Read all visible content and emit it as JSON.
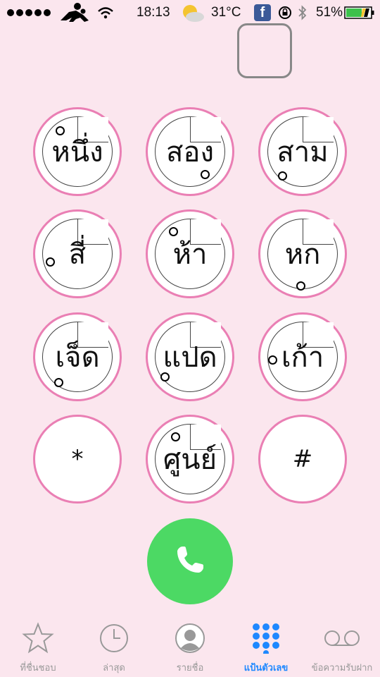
{
  "status_bar": {
    "time": "18:13",
    "temperature": "31°C",
    "battery_percent": "51%",
    "fb_glyph": "f",
    "icons": [
      "signal-dots-icon",
      "person-pose-icon",
      "wifi-icon",
      "weather-sun-icon",
      "facebook-icon",
      "rotation-lock-icon",
      "bluetooth-icon",
      "battery-icon"
    ]
  },
  "keypad": {
    "keys": [
      {
        "label": "หนึ่ง"
      },
      {
        "label": "สอง"
      },
      {
        "label": "สาม"
      },
      {
        "label": "สี่"
      },
      {
        "label": "ห้า"
      },
      {
        "label": "หก"
      },
      {
        "label": "เจ็ด"
      },
      {
        "label": "แปด"
      },
      {
        "label": "เก้า"
      },
      {
        "label": "*"
      },
      {
        "label": "ศูนย์"
      },
      {
        "label": "#"
      }
    ]
  },
  "tabbar": {
    "tabs": [
      {
        "label": "ที่ชื่นชอบ",
        "icon": "star-icon"
      },
      {
        "label": "ล่าสุด",
        "icon": "clock-icon"
      },
      {
        "label": "รายชื่อ",
        "icon": "contact-icon"
      },
      {
        "label": "แป้นตัวเลข",
        "icon": "keypad-grid-icon",
        "active": true
      },
      {
        "label": "ข้อความรับฝาก",
        "icon": "voicemail-icon"
      }
    ],
    "active_color": "#1e88ff",
    "inactive_color": "#999999"
  },
  "colors": {
    "background": "#fbe6ee",
    "key_ring": "#ea7fb4",
    "call_green": "#4cd964"
  }
}
